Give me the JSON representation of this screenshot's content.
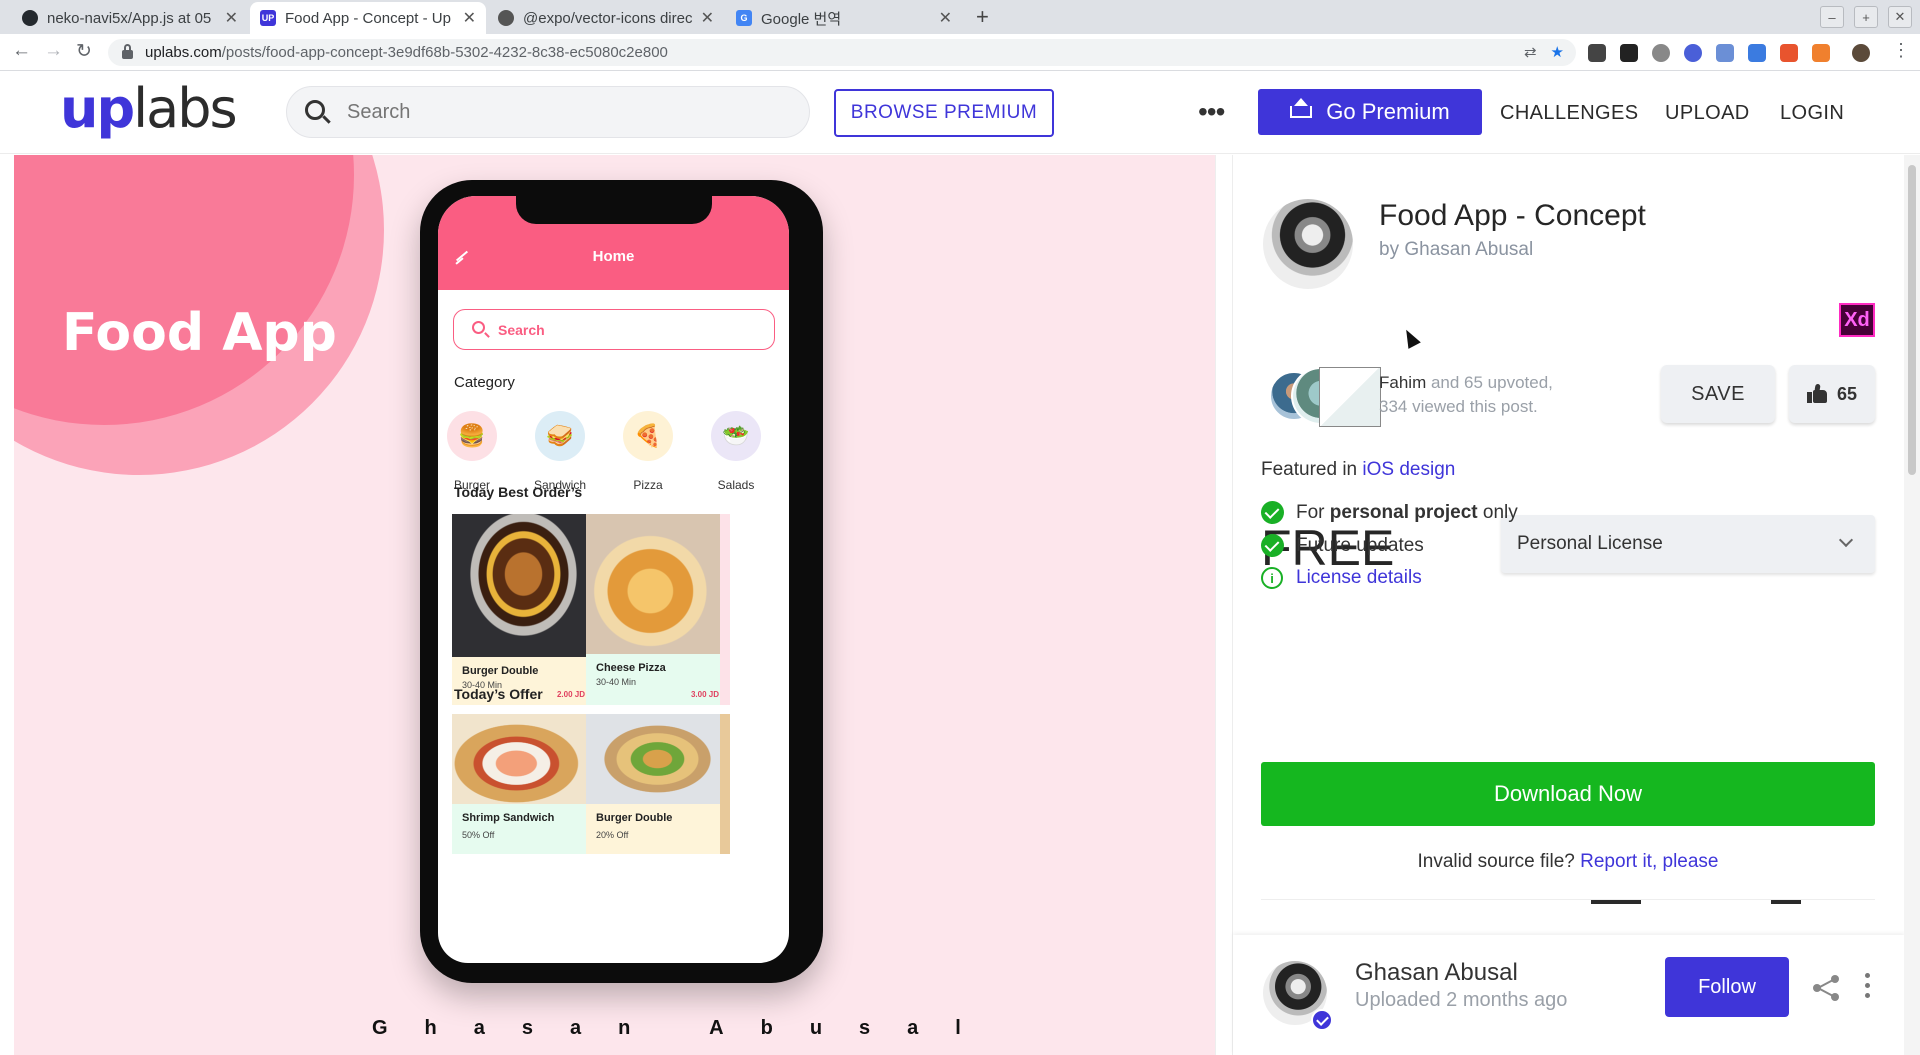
{
  "browser": {
    "tabs": [
      {
        "title": "neko-navi5x/App.js at 05",
        "favicon": "github-icon"
      },
      {
        "title": "Food App - Concept - Up",
        "favicon": "uplabs-icon",
        "active": true
      },
      {
        "title": "@expo/vector-icons direc",
        "favicon": "globe-icon"
      },
      {
        "title": "Google 번역",
        "favicon": "google-translate-icon"
      }
    ],
    "url_host": "uplabs.com",
    "url_path": "/posts/food-app-concept-3e9df68b-5302-4232-8c38-ec5080c2e800"
  },
  "header": {
    "logo_up": "up",
    "logo_labs": "labs",
    "search_placeholder": "Search",
    "browse_premium": "BROWSE PREMIUM",
    "more": "•••",
    "go_premium": "Go Premium",
    "challenges": "CHALLENGES",
    "upload": "UPLOAD",
    "login": "LOGIN"
  },
  "preview": {
    "hero_title": "Food App",
    "designer_signature": "Ghasan Abusal",
    "app": {
      "title": "Home",
      "search": "Search",
      "category_title": "Category",
      "categories": [
        "Burger",
        "Sandwich",
        "Pizza",
        "Salads"
      ],
      "best_title": "Today Best Order’s",
      "best": [
        {
          "name": "Burger Double",
          "time": "30-40 Min",
          "price": "2.00 JD"
        },
        {
          "name": "Cheese Pizza",
          "time": "30-40 Min",
          "price": "3.00 JD"
        }
      ],
      "offer_title": "Today’s Offer",
      "offers": [
        {
          "name": "Shrimp Sandwich",
          "discount": "50% Off"
        },
        {
          "name": "Burger Double",
          "discount": "20% Off"
        }
      ]
    }
  },
  "post": {
    "title": "Food App - Concept",
    "by": "by Ghasan Abusal",
    "tool_badge": "Xd",
    "upvoter": "Fahim",
    "upvote_rest": " and 65 upvoted,",
    "views": "334 viewed this post.",
    "save": "SAVE",
    "likes": "65",
    "featured_prefix": "Featured in ",
    "featured_link": "iOS design",
    "price": "FREE",
    "license": "Personal License",
    "features": {
      "f1_pre": "For ",
      "f1_bold": "personal project",
      "f1_post": " only",
      "f2": "Future updates",
      "f3": "License details"
    },
    "download": "Download Now",
    "invalid_text": "Invalid source file? ",
    "invalid_link": "Report it, please"
  },
  "author": {
    "name": "Ghasan Abusal",
    "uploaded": "Uploaded 2 months ago",
    "follow": "Follow"
  },
  "colors": {
    "brand": "#3f35d9",
    "download": "#15b71f",
    "app_pink": "#fa5d82",
    "preview_bg": "#fde6ec"
  }
}
